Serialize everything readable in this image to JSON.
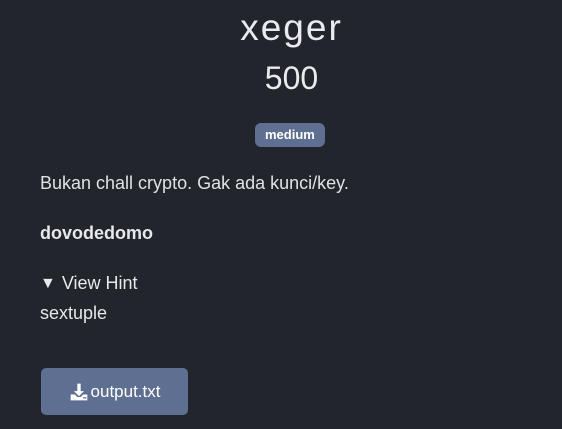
{
  "challenge": {
    "title": "xeger",
    "points": "500",
    "difficulty": "medium",
    "description": "Bukan chall crypto. Gak ada kunci/key.",
    "bold_text": "dovodedomo",
    "hint_toggle_label": "View Hint",
    "hint_text": "sextuple"
  },
  "files": [
    {
      "label": "output.txt",
      "icon": "download-icon"
    }
  ],
  "colors": {
    "background": "#22252b",
    "badge": "#5f6f91",
    "button": "#5f6f91",
    "text": "#e6e8ec"
  }
}
